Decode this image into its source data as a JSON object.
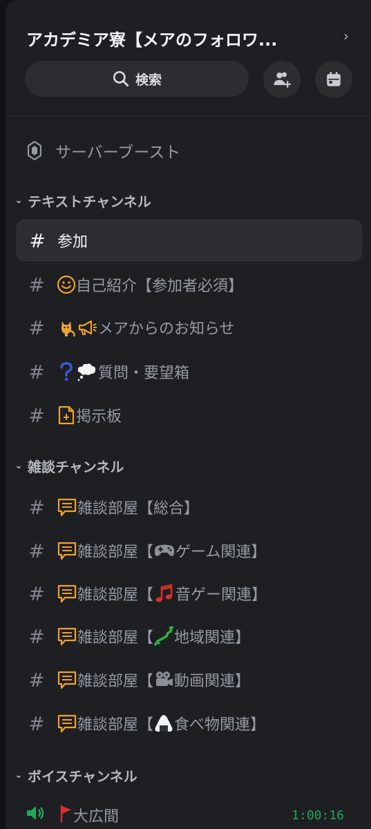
{
  "server": {
    "name": "アカデミア寮【メアのフォロワ...",
    "search_label": "検索"
  },
  "boost_label": "サーバーブースト",
  "categories": {
    "text": "テキストチャンネル",
    "chat": "雑談チャンネル",
    "voice": "ボイスチャンネル"
  },
  "text_channels": [
    {
      "emoji": "",
      "name": "参加"
    },
    {
      "emoji": "smile",
      "name": "自己紹介【参加者必須】"
    },
    {
      "emoji": "cat-megaphone",
      "name": "メアからのお知らせ"
    },
    {
      "emoji": "question-thought",
      "name": "質問・要望箱"
    },
    {
      "emoji": "clipboard",
      "name": "掲示板"
    }
  ],
  "chat_channels": [
    {
      "prefix": "雑談部屋【",
      "emoji": "gamepad",
      "name": "総合】"
    },
    {
      "prefix": "雑談部屋【",
      "emoji": "gamepad-icon",
      "name": "ゲーム関連】"
    },
    {
      "prefix": "雑談部屋【",
      "emoji": "music-notes",
      "name": "音ゲー関連】"
    },
    {
      "prefix": "雑談部屋【",
      "emoji": "japan-map",
      "name": "地域関連】"
    },
    {
      "prefix": "雑談部屋【",
      "emoji": "film-camera",
      "name": "動画関連】"
    },
    {
      "prefix": "雑談部屋【",
      "emoji": "onigiri",
      "name": "食べ物関連】"
    }
  ],
  "voice_channels": [
    {
      "name": "大広間",
      "timer": "1:00:16"
    }
  ],
  "colors": {
    "background": "#1e1f22",
    "active_row": "#2b2d31",
    "accent_green": "#23a55a",
    "speech_icon": "#f0a232"
  }
}
